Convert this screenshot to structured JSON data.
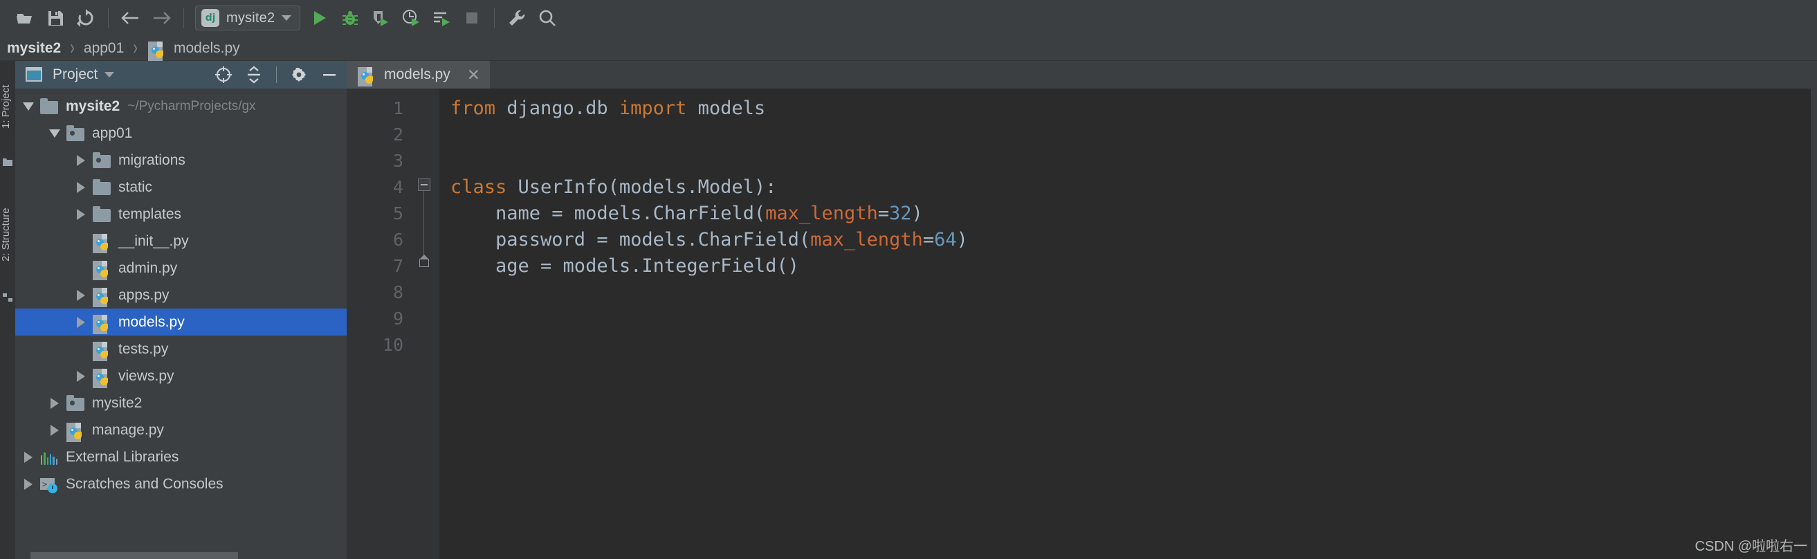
{
  "toolbar": {
    "buttons": [
      {
        "name": "open-folder-icon",
        "label": "Open"
      },
      {
        "name": "save-icon",
        "label": "Save All"
      },
      {
        "name": "sync-icon",
        "label": "Synchronize"
      },
      {
        "name": "back-arrow-icon",
        "label": "Back"
      },
      {
        "name": "forward-arrow-icon",
        "label": "Forward"
      }
    ],
    "run_config": {
      "badge": "dj",
      "name": "mysite2",
      "dropdown_icon": "chevron-down-icon"
    },
    "run_buttons": [
      {
        "name": "run-icon",
        "label": "Run"
      },
      {
        "name": "debug-icon",
        "label": "Debug"
      },
      {
        "name": "run-with-coverage-icon",
        "label": "Run with Coverage"
      },
      {
        "name": "profile-icon",
        "label": "Profile"
      },
      {
        "name": "run-with-console-icon",
        "label": "Run with Console"
      },
      {
        "name": "stop-icon",
        "label": "Stop"
      }
    ],
    "right_buttons": [
      {
        "name": "settings-wrench-icon",
        "label": "Settings"
      },
      {
        "name": "search-icon",
        "label": "Search Everywhere"
      }
    ]
  },
  "breadcrumb": {
    "items": [
      {
        "label": "mysite2",
        "icon": null,
        "bold": true
      },
      {
        "label": "app01",
        "icon": null,
        "bold": false
      },
      {
        "label": "models.py",
        "icon": "python-file-icon",
        "bold": false
      }
    ],
    "separator": "›"
  },
  "left_strip": {
    "project_label": "1: Project",
    "structure_label": "2: Structure"
  },
  "project_panel": {
    "title": "Project",
    "dropdown_icon": "chevron-down-icon",
    "header_icons": [
      {
        "name": "locate-target-icon",
        "label": "Select Opened File"
      },
      {
        "name": "collapse-all-icon",
        "label": "Collapse All"
      },
      {
        "name": "gear-icon",
        "label": "Settings"
      },
      {
        "name": "minimize-icon",
        "label": "Hide"
      }
    ],
    "tree": [
      {
        "label": "mysite2",
        "path": "~/PycharmProjects/gx",
        "indent": 0,
        "twist": "down",
        "icon": "folder-icon",
        "bold": true,
        "selected": false
      },
      {
        "label": "app01",
        "path": "",
        "indent": 1,
        "twist": "down",
        "icon": "folder-source-icon",
        "bold": false,
        "selected": false
      },
      {
        "label": "migrations",
        "path": "",
        "indent": 2,
        "twist": "right",
        "icon": "folder-source-icon",
        "bold": false,
        "selected": false
      },
      {
        "label": "static",
        "path": "",
        "indent": 2,
        "twist": "right",
        "icon": "folder-icon",
        "bold": false,
        "selected": false
      },
      {
        "label": "templates",
        "path": "",
        "indent": 2,
        "twist": "right",
        "icon": "folder-icon",
        "bold": false,
        "selected": false
      },
      {
        "label": "__init__.py",
        "path": "",
        "indent": 2,
        "twist": "none",
        "icon": "python-file-icon",
        "bold": false,
        "selected": false
      },
      {
        "label": "admin.py",
        "path": "",
        "indent": 2,
        "twist": "none",
        "icon": "python-file-icon",
        "bold": false,
        "selected": false
      },
      {
        "label": "apps.py",
        "path": "",
        "indent": 2,
        "twist": "right",
        "icon": "python-file-icon",
        "bold": false,
        "selected": false
      },
      {
        "label": "models.py",
        "path": "",
        "indent": 2,
        "twist": "right",
        "icon": "python-file-icon",
        "bold": false,
        "selected": true
      },
      {
        "label": "tests.py",
        "path": "",
        "indent": 2,
        "twist": "none",
        "icon": "python-file-icon",
        "bold": false,
        "selected": false
      },
      {
        "label": "views.py",
        "path": "",
        "indent": 2,
        "twist": "right",
        "icon": "python-file-icon",
        "bold": false,
        "selected": false
      },
      {
        "label": "mysite2",
        "path": "",
        "indent": 1,
        "twist": "right",
        "icon": "folder-source-icon",
        "bold": false,
        "selected": false
      },
      {
        "label": "manage.py",
        "path": "",
        "indent": 1,
        "twist": "right",
        "icon": "python-file-icon",
        "bold": false,
        "selected": false
      },
      {
        "label": "External Libraries",
        "path": "",
        "indent": 0,
        "twist": "right",
        "icon": "external-libraries-icon",
        "bold": false,
        "selected": false
      },
      {
        "label": "Scratches and Consoles",
        "path": "",
        "indent": 0,
        "twist": "right",
        "icon": "scratches-icon",
        "bold": false,
        "selected": false
      }
    ]
  },
  "editor": {
    "tabs": [
      {
        "label": "models.py",
        "icon": "python-file-icon",
        "close_icon": "close-icon",
        "active": true
      }
    ],
    "line_numbers": [
      "1",
      "2",
      "3",
      "4",
      "5",
      "6",
      "7",
      "8",
      "9",
      "10"
    ],
    "lines": [
      {
        "n": 1,
        "tokens": [
          {
            "t": "from",
            "c": "kw"
          },
          {
            "t": " django.db ",
            "c": "id"
          },
          {
            "t": "import",
            "c": "kw"
          },
          {
            "t": " models",
            "c": "id"
          }
        ]
      },
      {
        "n": 2,
        "tokens": []
      },
      {
        "n": 3,
        "tokens": []
      },
      {
        "n": 4,
        "tokens": [
          {
            "t": "class",
            "c": "kw"
          },
          {
            "t": " UserInfo(models.Model):",
            "c": "id"
          }
        ]
      },
      {
        "n": 5,
        "tokens": [
          {
            "t": "    name = models.CharField(",
            "c": "id"
          },
          {
            "t": "max_length",
            "c": "param"
          },
          {
            "t": "=",
            "c": "id"
          },
          {
            "t": "32",
            "c": "num"
          },
          {
            "t": ")",
            "c": "id"
          }
        ]
      },
      {
        "n": 6,
        "tokens": [
          {
            "t": "    password = models.CharField(",
            "c": "id"
          },
          {
            "t": "max_length",
            "c": "param"
          },
          {
            "t": "=",
            "c": "id"
          },
          {
            "t": "64",
            "c": "num"
          },
          {
            "t": ")",
            "c": "id"
          }
        ]
      },
      {
        "n": 7,
        "tokens": [
          {
            "t": "    age = models.IntegerField()",
            "c": "id"
          }
        ]
      },
      {
        "n": 8,
        "tokens": []
      },
      {
        "n": 9,
        "tokens": []
      },
      {
        "n": 10,
        "tokens": []
      }
    ],
    "fold_markers": [
      {
        "line": 4,
        "type": "collapse"
      },
      {
        "line": 7,
        "type": "end"
      }
    ]
  },
  "watermark": "CSDN @啦啦右一",
  "colors": {
    "toolbar_bg": "#3c3f41",
    "panel_bg": "#3c3f41",
    "panel_header_bg": "#41525f",
    "editor_bg": "#2b2b2b",
    "gutter_bg": "#313335",
    "selection_blue": "#2a63c4",
    "keyword_orange": "#cc7832",
    "number_blue": "#6897bb",
    "text_gray": "#a9b7c6",
    "run_green": "#5a9e63"
  }
}
